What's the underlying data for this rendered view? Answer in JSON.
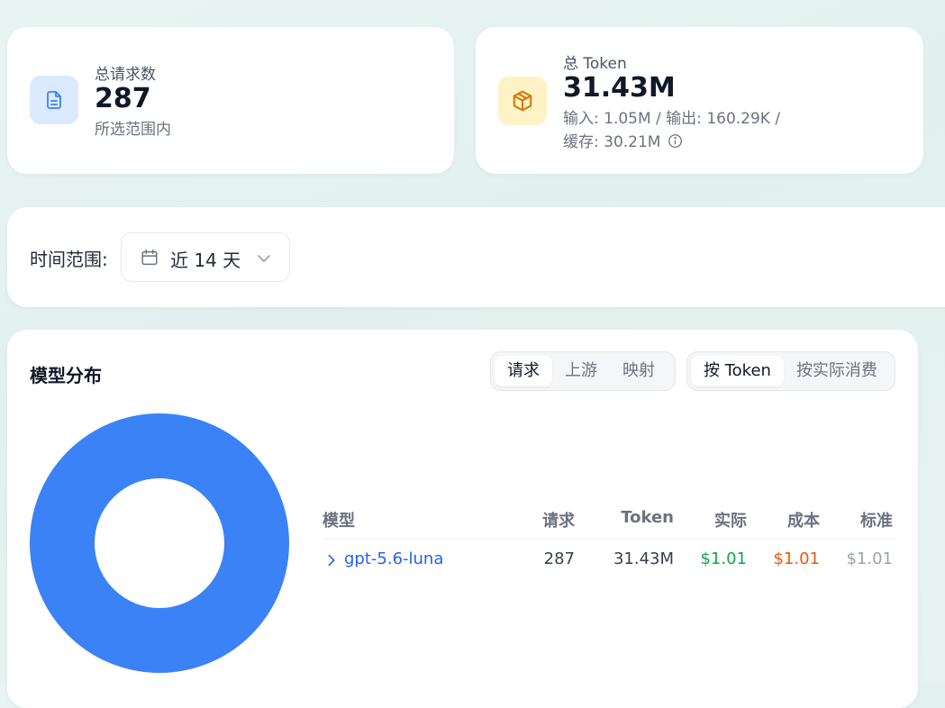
{
  "stats": {
    "requests": {
      "label": "总请求数",
      "value": "287",
      "sub": "所选范围内",
      "icon": "document-icon",
      "accent": "#3b82f6",
      "bg": "#dbeafe"
    },
    "token": {
      "label": "总 Token",
      "value": "31.43M",
      "sub_line1": "输入: 1.05M / 输出: 160.29K /",
      "sub_line2": "缓存: 30.21M",
      "icon": "box-icon",
      "accent": "#d97706",
      "bg": "#fef3c7"
    }
  },
  "range": {
    "label": "时间范围:",
    "value": "近 14 天"
  },
  "distribution": {
    "title": "模型分布",
    "group1": [
      "请求",
      "上游",
      "映射"
    ],
    "group1_active": "请求",
    "group2": [
      "按 Token",
      "按实际消费"
    ],
    "group2_active": "按 Token",
    "donut_color": "#3b82f6",
    "table": {
      "headers": {
        "model": "模型",
        "requests": "请求",
        "token": "Token",
        "actual": "实际",
        "cost": "成本",
        "standard": "标准"
      },
      "rows": [
        {
          "model": "gpt-5.6-luna",
          "requests": "287",
          "token": "31.43M",
          "actual": "$1.01",
          "cost": "$1.01",
          "standard": "$1.01",
          "share": 1.0
        }
      ]
    },
    "colors": {
      "model_link": "#2563eb",
      "actual": "#16a34a",
      "cost": "#ea580c",
      "standard": "#9ca3af"
    }
  }
}
